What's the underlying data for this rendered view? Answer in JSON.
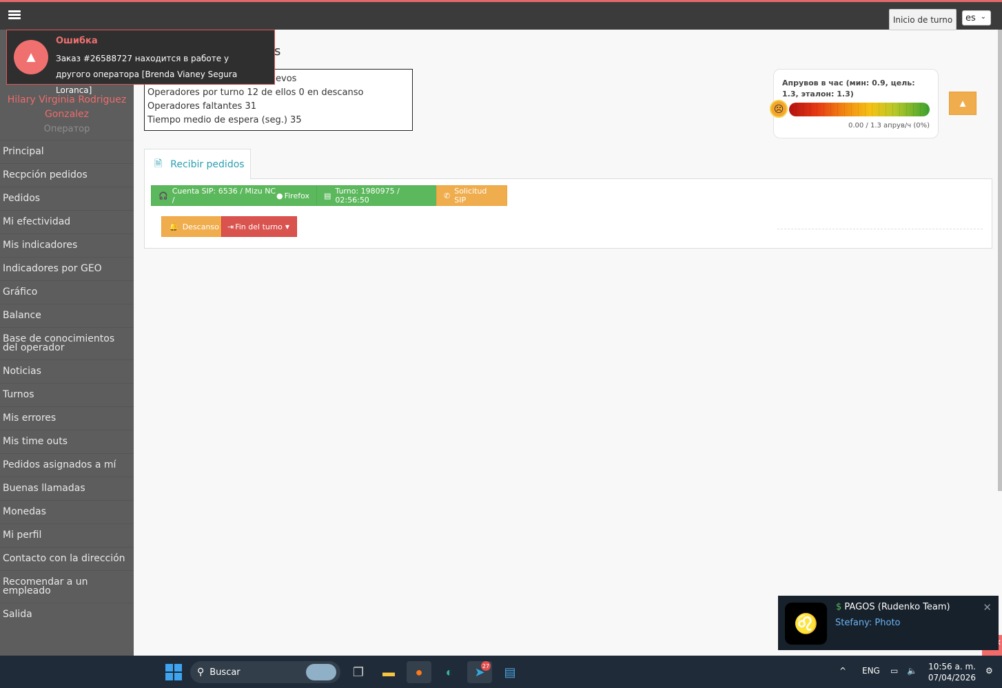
{
  "topbar": {
    "shift_button": "Inicio de turno",
    "language": "es"
  },
  "error_toast": {
    "title": "Ошибка",
    "message": "Заказ #26588727 находится в работе у другого оператора [Brenda Vianey Segura Loranca]"
  },
  "sidebar": {
    "user_name": "Hilary Virginia Rodriguez Gonzalez",
    "user_role": "Оператор",
    "items": [
      {
        "label": "Principal"
      },
      {
        "label": "Recpción pedidos"
      },
      {
        "label": "Pedidos"
      },
      {
        "label": "Mi efectividad"
      },
      {
        "label": "Mis indicadores"
      },
      {
        "label": "Indicadores por GEO"
      },
      {
        "label": "Gráfico"
      },
      {
        "label": "Balance"
      },
      {
        "label": "Base de conocimientos del operador"
      },
      {
        "label": "Noticias"
      },
      {
        "label": "Turnos"
      },
      {
        "label": "Mis errores"
      },
      {
        "label": "Mis time outs"
      },
      {
        "label": "Pedidos asignados a mí"
      },
      {
        "label": "Buenas llamadas"
      },
      {
        "label": "Monedas"
      },
      {
        "label": "Mi perfil"
      },
      {
        "label": "Contacto con la dirección"
      },
      {
        "label": "Recomendar a un empleado"
      },
      {
        "label": "Salida"
      }
    ]
  },
  "main": {
    "title_tail": "s",
    "info_lines": [
      "evos",
      "Operadores por turno 12 de ellos 0 en descanso",
      "Operadores faltantes 31",
      "Tiempo medio de espera (seg.) 35"
    ],
    "tab_label": "Recibir pedidos"
  },
  "approve_widget": {
    "title": "Апрувов в час (мин: 0.9, цель: 1.3, эталон: 1.3)",
    "value_text": "0.00 / 1.3 апрув/ч (0%)",
    "progress_fraction": 0.0
  },
  "status_bar": {
    "sip_account": "Cuenta SIP: 6536 / Mizu NC / ",
    "browser": "Firefox",
    "shift": "Turno: 1980975 / 02:56:50",
    "sip_request": "Solicitud SIP"
  },
  "actions": {
    "break_label": "Descanso",
    "end_shift_label": "Fin del turno"
  },
  "telegram_toast": {
    "chat": "PAGOS (Rudenko Team)",
    "sender": "Stefany:",
    "message": "Photo"
  },
  "taskbar": {
    "search_label": "Buscar",
    "telegram_badge": "27",
    "language": "ENG",
    "time": "10:56 a. m.",
    "date": "07/04/2026"
  },
  "colors": {
    "topbar": "#3b3b3b",
    "sidebar": "#5d5d5d",
    "accent_red": "#e2696b",
    "success": "#5cb85c",
    "warning": "#f0ad4e",
    "danger": "#d9534f",
    "tab_text": "#2a9fb0"
  },
  "icons": [
    "menu-icon",
    "warning-icon",
    "sad-sun-icon",
    "document-icon",
    "headset-icon",
    "firefox-icon",
    "card-icon",
    "phone-icon",
    "bell-icon",
    "logout-icon",
    "caret-down-icon",
    "close-icon",
    "windows-icon",
    "search-icon"
  ]
}
